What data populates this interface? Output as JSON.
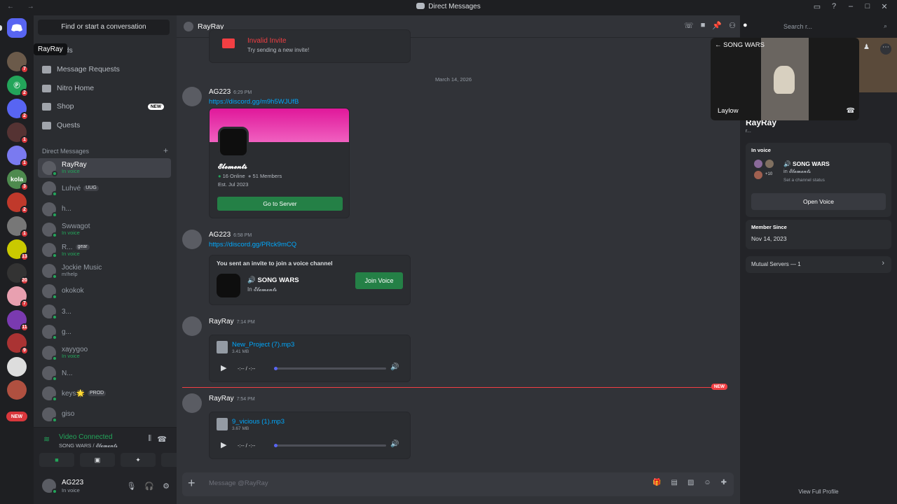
{
  "titlebar": {
    "nav": "← →",
    "title": "Direct Messages"
  },
  "guilds": {
    "servers": [
      {
        "label": "",
        "badge": "7",
        "color": "#6b5a4a"
      },
      {
        "label": "Ⓟ",
        "badge": "2",
        "color": "#23a55a"
      },
      {
        "label": "",
        "badge": "2",
        "color": "#5865f2"
      },
      {
        "label": "",
        "badge": "1",
        "color": "#553333"
      },
      {
        "label": "",
        "badge": "1",
        "color": "#7a7af0"
      },
      {
        "label": "kola",
        "badge": "3",
        "color": "#4e8a4e"
      },
      {
        "label": "",
        "badge": "2",
        "color": "#c0392b"
      },
      {
        "label": "",
        "badge": "1",
        "color": "#777"
      },
      {
        "label": "",
        "badge": "13",
        "color": "#c9c900"
      },
      {
        "label": "",
        "badge": "20",
        "color": "#333"
      },
      {
        "label": "",
        "badge": "7",
        "color": "#e8a0b0"
      },
      {
        "label": "",
        "badge": "11",
        "color": "#7a3ab0"
      },
      {
        "label": "",
        "badge": "9",
        "color": "#aa3333"
      },
      {
        "label": "",
        "badge": "",
        "color": "#dddddd"
      },
      {
        "label": "",
        "badge": "",
        "color": "#b05040"
      }
    ],
    "new_label": "NEW",
    "tooltip": "RayRay"
  },
  "sidebar": {
    "search_label": "Find or start a conversation",
    "nav": [
      {
        "label": "Friends",
        "visible": "ends"
      },
      {
        "label": "Message Requests"
      },
      {
        "label": "Nitro Home"
      },
      {
        "label": "Shop",
        "badge": "NEW"
      },
      {
        "label": "Quests"
      }
    ],
    "dm_header": "Direct Messages",
    "dms": [
      {
        "name": "RayRay",
        "sub": "In voice",
        "tag": ""
      },
      {
        "name": "Luhvé",
        "sub": "",
        "tag": "UUG"
      },
      {
        "name": "h...",
        "sub": "",
        "tag": ""
      },
      {
        "name": "Swwagot",
        "sub": "In voice",
        "tag": ""
      },
      {
        "name": "R...",
        "sub": "In voice",
        "tag": "gear"
      },
      {
        "name": "Jockie Music",
        "sub": "m!help",
        "tag": ""
      },
      {
        "name": "okokok",
        "sub": "",
        "tag": ""
      },
      {
        "name": "3...",
        "sub": "",
        "tag": ""
      },
      {
        "name": "g...",
        "sub": "",
        "tag": ""
      },
      {
        "name": "xayygoo",
        "sub": "In voice",
        "tag": ""
      },
      {
        "name": "N...",
        "sub": "",
        "tag": ""
      },
      {
        "name": "keys🌟",
        "sub": "",
        "tag": "PROD"
      },
      {
        "name": "giso",
        "sub": "",
        "tag": ""
      }
    ],
    "voice": {
      "status": "Video Connected",
      "channel": "SONG WARS / 𝓔𝓵𝓮𝓶𝓮𝓷𝓽𝓼"
    },
    "user": {
      "name": "AG223",
      "status": "In voice"
    }
  },
  "chat": {
    "recipient": "RayRay",
    "search_placeholder": "Search r...",
    "invalid_invite": {
      "title": "Invalid Invite",
      "sub": "Try sending a new invite!"
    },
    "date": "March 14, 2026",
    "msg1": {
      "author": "AG223",
      "time": "6:29 PM",
      "link": "https://discord.gg/m9h5WJUfB"
    },
    "server_card": {
      "name": "𝓔𝓵𝓮𝓶𝓮𝓷𝓽𝓼",
      "online": "16 Online",
      "members": "51 Members",
      "est": "Est. Jul 2023",
      "button": "Go to Server"
    },
    "msg2": {
      "author": "AG223",
      "time": "6:58 PM",
      "link": "https://discord.gg/PRck9mCQ"
    },
    "voice_invite": {
      "title": "You sent an invite to join a voice channel",
      "channel": "SONG WARS",
      "server": "In 𝓔𝓵𝓮𝓶𝓮𝓷𝓽𝓼",
      "button": "Join Voice"
    },
    "msg3": {
      "author": "RayRay",
      "time": "7:14 PM",
      "file": "New_Project (7).mp3",
      "size": "3.41 MB",
      "playtime": "-:-- / -:--"
    },
    "new_marker": "NEW",
    "msg4": {
      "author": "RayRay",
      "time": "7:54 PM",
      "file": "9_vicious (1).mp3",
      "size": "3.67 MB",
      "playtime": "-:-- / -:--"
    },
    "composer_placeholder": "Message @RayRay"
  },
  "voice_popout": {
    "title": "← SONG WARS",
    "user": "Laylow"
  },
  "profile": {
    "name": "RayRay",
    "tag": "r...",
    "in_voice_label": "In voice",
    "voice_channel": "🔊 SONG WARS",
    "voice_server": "in 𝓔𝓵𝓮𝓶𝓮𝓷𝓽𝓼",
    "more_count": "+10",
    "channel_status": "Set a channel status",
    "open_voice": "Open Voice",
    "member_since_label": "Member Since",
    "member_since": "Nov 14, 2023",
    "mutual": "Mutual Servers — 1",
    "view_full": "View Full Profile"
  },
  "colors": {
    "accent": "#5865f2",
    "green": "#23a55a",
    "red": "#f23f43",
    "link": "#00a8fc"
  }
}
